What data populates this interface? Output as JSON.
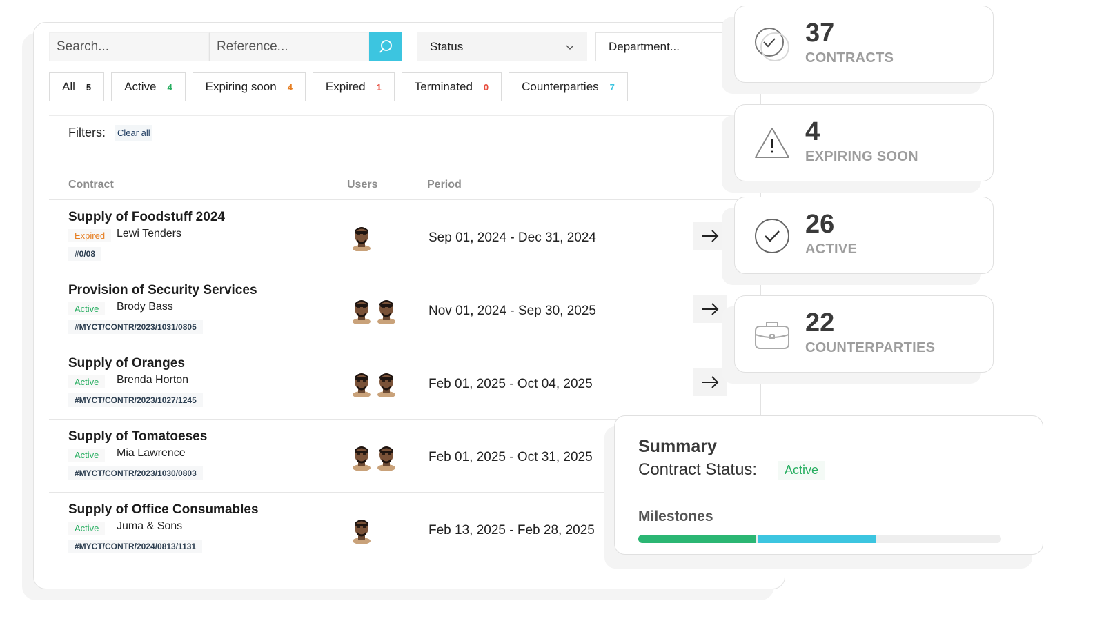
{
  "search": {
    "placeholder": "Search...",
    "reference_placeholder": "Reference..."
  },
  "selects": {
    "status": "Status",
    "department": "Department..."
  },
  "tabs": [
    {
      "label": "All",
      "count": "5",
      "color": "#222222"
    },
    {
      "label": "Active",
      "count": "4",
      "color": "#27ae60"
    },
    {
      "label": "Expiring soon",
      "count": "4",
      "color": "#e67e22"
    },
    {
      "label": "Expired",
      "count": "1",
      "color": "#e74c3c"
    },
    {
      "label": "Terminated",
      "count": "0",
      "color": "#e74c3c"
    },
    {
      "label": "Counterparties",
      "count": "7",
      "color": "#3cc5e0"
    }
  ],
  "filters": {
    "label": "Filters:",
    "clear": "Clear all"
  },
  "table": {
    "headers": {
      "contract": "Contract",
      "users": "Users",
      "period": "Period"
    },
    "rows": [
      {
        "title": "Supply of Foodstuff 2024",
        "status": "Expired",
        "status_color": "#e67e22",
        "party": "Lewi Tenders",
        "ref": "#0/08",
        "users": 1,
        "period": "Sep 01, 2024 - Dec 31, 2024"
      },
      {
        "title": "Provision of Security Services",
        "status": "Active",
        "status_color": "#27ae60",
        "party": "Brody Bass",
        "ref": "#MYCT/CONTR/2023/1031/0805",
        "users": 2,
        "period": "Nov 01, 2024 - Sep 30, 2025"
      },
      {
        "title": "Supply of Oranges",
        "status": "Active",
        "status_color": "#27ae60",
        "party": "Brenda Horton",
        "ref": "#MYCT/CONTR/2023/1027/1245",
        "users": 2,
        "period": "Feb 01, 2025 - Oct 04, 2025"
      },
      {
        "title": "Supply of Tomatoeses",
        "status": "Active",
        "status_color": "#27ae60",
        "party": "Mia Lawrence",
        "ref": "#MYCT/CONTR/2023/1030/0803",
        "users": 2,
        "period": "Feb 01, 2025 - Oct 31, 2025"
      },
      {
        "title": "Supply of Office Consumables",
        "status": "Active",
        "status_color": "#27ae60",
        "party": "Juma & Sons",
        "ref": "#MYCT/CONTR/2024/0813/1131",
        "users": 1,
        "period": "Feb 13, 2025 - Feb 28, 2025"
      }
    ]
  },
  "stats": [
    {
      "value": "37",
      "label": "CONTRACTS",
      "icon": "double-check-circle-icon"
    },
    {
      "value": "4",
      "label": "EXPIRING SOON",
      "icon": "warning-triangle-icon"
    },
    {
      "value": "26",
      "label": "ACTIVE",
      "icon": "check-circle-icon"
    },
    {
      "value": "22",
      "label": "COUNTERPARTIES",
      "icon": "briefcase-icon"
    }
  ],
  "summary": {
    "title": "Summary",
    "status_label": "Contract Status:",
    "status_value": "Active",
    "milestones_label": "Milestones",
    "milestones": [
      {
        "fraction": 0.33,
        "color": "#2bb673"
      },
      {
        "fraction": 0.33,
        "color": "#3cc5e0"
      }
    ]
  },
  "colors": {
    "accent": "#3cc5e0",
    "active": "#27ae60",
    "expired": "#e67e22"
  }
}
